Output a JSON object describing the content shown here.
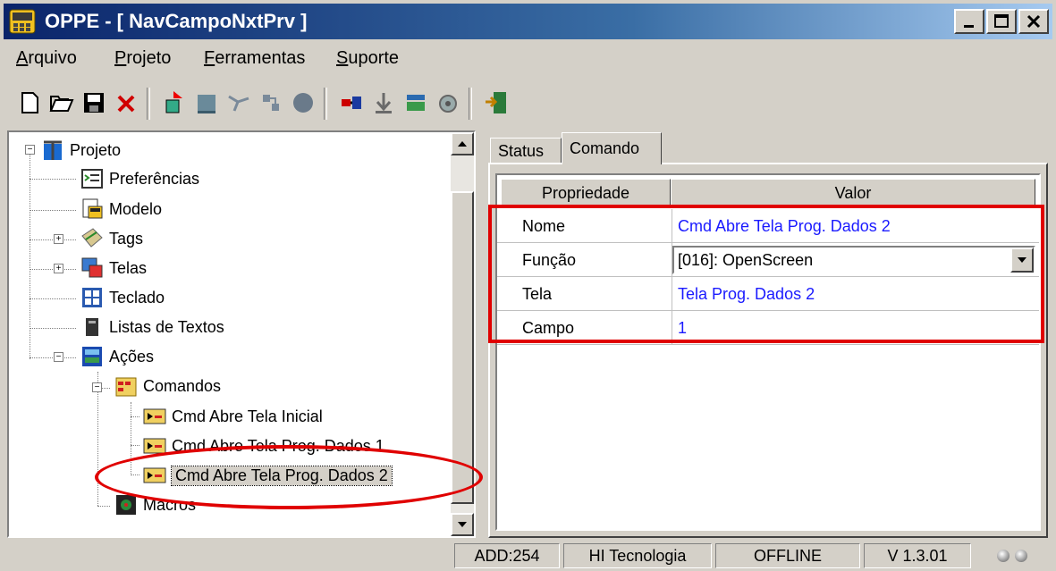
{
  "window": {
    "title": "OPPE - [ NavCampoNxtPrv ]",
    "controls": {
      "minimize": "_",
      "maximize": "□",
      "close": "×"
    }
  },
  "menu": [
    {
      "label": "Arquivo"
    },
    {
      "label": "Projeto"
    },
    {
      "label": "Ferramentas"
    },
    {
      "label": "Suporte"
    }
  ],
  "toolbar": {
    "icons": [
      "new-icon",
      "open-icon",
      "save-icon",
      "delete-icon",
      "transfer-icon",
      "stop-icon",
      "connect-icon",
      "network-icon",
      "record-icon",
      "plugin-icon",
      "download-icon",
      "tools-icon",
      "settings-icon",
      "exit-icon"
    ]
  },
  "tree": {
    "items": [
      {
        "label": "Projeto"
      },
      {
        "label": "Preferências"
      },
      {
        "label": "Modelo"
      },
      {
        "label": "Tags"
      },
      {
        "label": "Telas"
      },
      {
        "label": "Teclado"
      },
      {
        "label": "Listas de Textos"
      },
      {
        "label": "Ações"
      },
      {
        "label": "Comandos"
      },
      {
        "label": "Cmd Abre Tela Inicial"
      },
      {
        "label": "Cmd Abre Tela Prog. Dados 1"
      },
      {
        "label": "Cmd Abre Tela Prog. Dados 2"
      },
      {
        "label": "Macros"
      }
    ]
  },
  "tabs": [
    {
      "label": "Status"
    },
    {
      "label": "Comando"
    }
  ],
  "grid": {
    "headers": [
      "Propriedade",
      "Valor"
    ],
    "rows": [
      {
        "prop": "Nome",
        "value": "Cmd Abre Tela Prog. Dados 2"
      },
      {
        "prop": "Função",
        "value": "[016]: OpenScreen"
      },
      {
        "prop": "Tela",
        "value": "Tela Prog. Dados 2"
      },
      {
        "prop": "Campo",
        "value": "1"
      }
    ]
  },
  "status": {
    "address": "ADD:254",
    "company": "HI Tecnologia",
    "connection": "OFFLINE",
    "version": "V 1.3.01"
  },
  "colors": {
    "titlebar_start": "#0a246a",
    "titlebar_end": "#a6caf0",
    "value_text": "#1a1aff",
    "highlight": "#e00000"
  }
}
